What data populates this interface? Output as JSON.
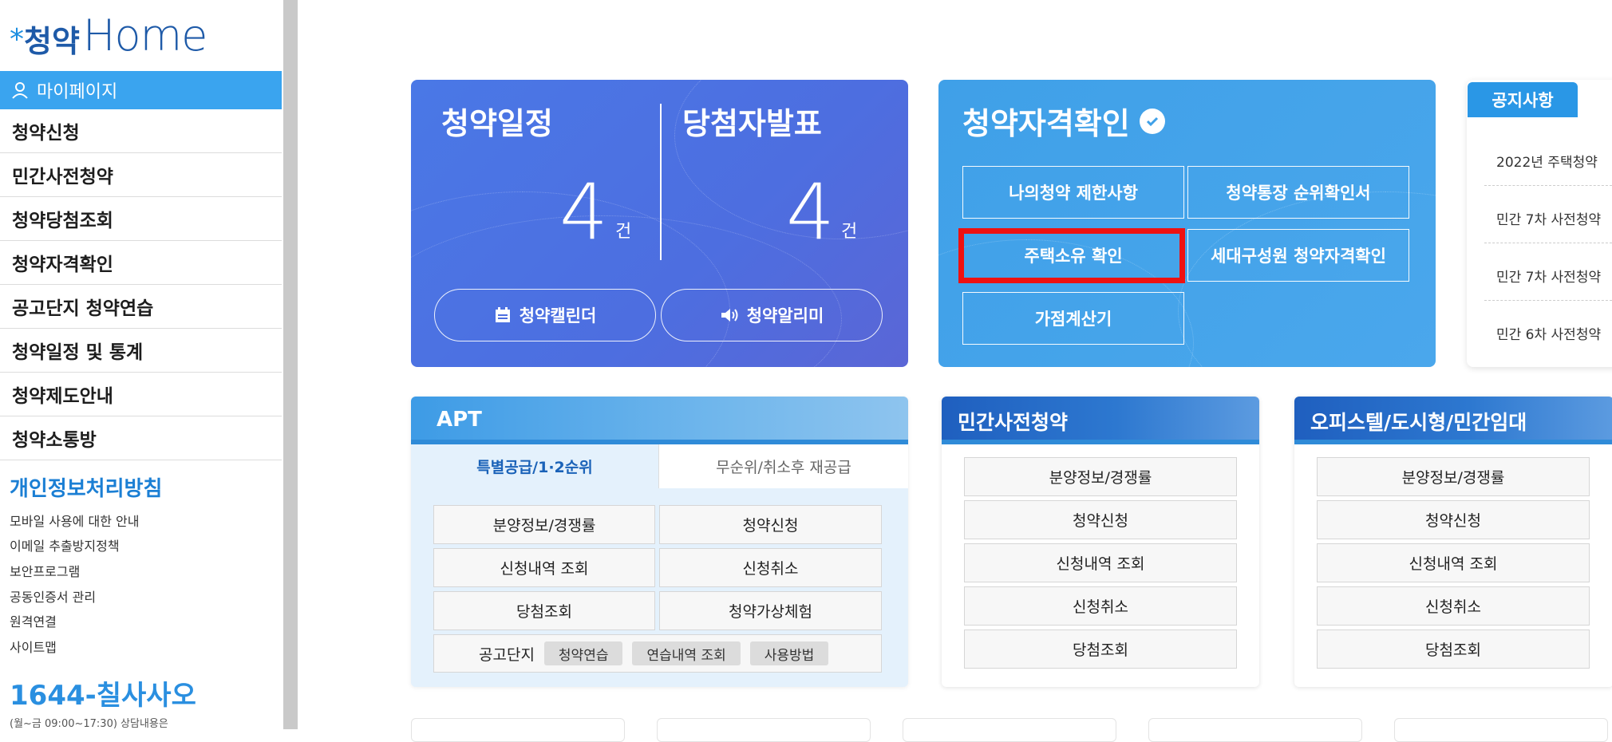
{
  "logo": {
    "text_ko": "청약",
    "text_en": "Home"
  },
  "sidebar": {
    "mypage": "마이페이지",
    "menu": [
      "청약신청",
      "민간사전청약",
      "청약당첨조회",
      "청약자격확인",
      "공고단지 청약연습",
      "청약일정 및 통계",
      "청약제도안내",
      "청약소통방"
    ],
    "privacy_title": "개인정보처리방침",
    "links": [
      "모바일 사용에 대한 안내",
      "이메일 추출방지정책",
      "보안프로그램",
      "공동인증서 관리",
      "원격연결",
      "사이트맵"
    ],
    "phone_prefix": "1644-",
    "phone_word": "칠사사오",
    "phone_note": "(월~금 09:00~17:30) 상담내용은"
  },
  "schedule_card": {
    "title_left": "청약일정",
    "title_right": "당첨자발표",
    "count_left": "4",
    "count_right": "4",
    "unit": "건",
    "calendar_btn": "청약캘린더",
    "alarm_btn": "청약알리미"
  },
  "eligibility_card": {
    "title": "청약자격확인",
    "buttons": [
      "나의청약 제한사항",
      "청약통장 순위확인서",
      "주택소유 확인",
      "세대구성원 청약자격확인",
      "가점계산기"
    ]
  },
  "notice": {
    "tab": "공지사항",
    "items": [
      "2022년 주택청약",
      "민간 7차 사전청약",
      "민간 7차 사전청약",
      "민간 6차 사전청약"
    ]
  },
  "apt": {
    "title": "APT",
    "tab_active": "특별공급/1·2순위",
    "tab_inactive": "무순위/취소후 재공급",
    "grid": [
      "분양정보/경쟁률",
      "청약신청",
      "신청내역 조회",
      "신청취소",
      "당첨조회",
      "청약가상체험"
    ],
    "practice_label": "공고단지",
    "chips": [
      "청약연습",
      "연습내역 조회",
      "사용방법"
    ]
  },
  "pre_sale": {
    "title": "민간사전청약",
    "items": [
      "분양정보/경쟁률",
      "청약신청",
      "신청내역 조회",
      "신청취소",
      "당첨조회"
    ]
  },
  "officetel": {
    "title": "오피스텔/도시형/민간임대",
    "items": [
      "분양정보/경쟁률",
      "청약신청",
      "신청내역 조회",
      "신청취소",
      "당첨조회"
    ]
  },
  "colors": {
    "accent": "#3aa4ef",
    "schedule_bg": "#4d6ee0",
    "highlight": "#ee1111",
    "brand": "#1e5aa8"
  }
}
